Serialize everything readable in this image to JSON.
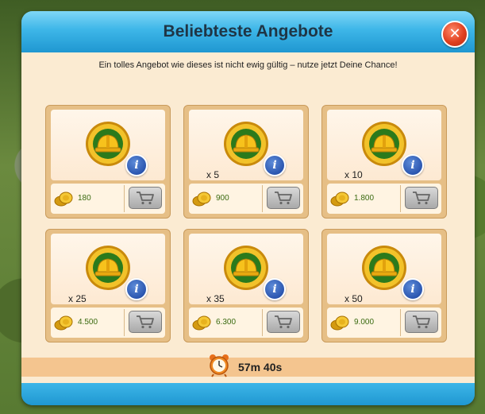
{
  "dialog": {
    "title": "Beliebteste Angebote",
    "subtitle": "Ein tolles Angebot wie dieses ist nicht ewig gültig – nutze jetzt Deine Chance!",
    "close_symbol": "✕",
    "info_symbol": "i",
    "timer": "57m 40s"
  },
  "offers": [
    {
      "quantity": "",
      "price": "180",
      "item_icon": "hard-hat-coin-icon"
    },
    {
      "quantity": "x 5",
      "price": "900",
      "item_icon": "hard-hat-coin-icon"
    },
    {
      "quantity": "x 10",
      "price": "1.800",
      "item_icon": "hard-hat-coin-icon"
    },
    {
      "quantity": "x 25",
      "price": "4.500",
      "item_icon": "hard-hat-coin-icon"
    },
    {
      "quantity": "x 35",
      "price": "6.300",
      "item_icon": "hard-hat-coin-icon"
    },
    {
      "quantity": "x 50",
      "price": "9.000",
      "item_icon": "hard-hat-coin-icon"
    }
  ],
  "colors": {
    "header_blue": "#2a9fd6",
    "panel_bg": "#fbebd2",
    "card_border": "#e6bf86",
    "price_text": "#3b6a10",
    "close_red": "#e0401f",
    "info_blue": "#2b56b0"
  }
}
